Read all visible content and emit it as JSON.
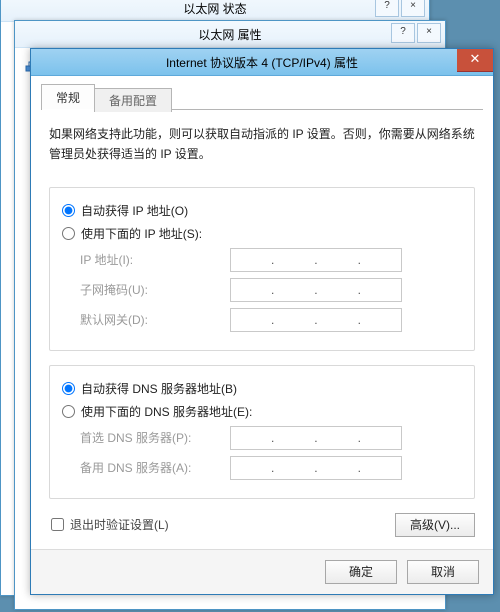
{
  "bg": {
    "win1_title": "以太网 状态",
    "win2_title": "以太网 属性"
  },
  "dialog": {
    "title": "Internet 协议版本 4 (TCP/IPv4) 属性",
    "tabs": {
      "general": "常规",
      "alt": "备用配置"
    },
    "description": "如果网络支持此功能，则可以获取自动指派的 IP 设置。否则，你需要从网络系统管理员处获得适当的 IP 设置。",
    "ip": {
      "auto": "自动获得 IP 地址(O)",
      "manual": "使用下面的 IP 地址(S):",
      "addr_label": "IP 地址(I):",
      "mask_label": "子网掩码(U):",
      "gw_label": "默认网关(D):"
    },
    "dns": {
      "auto": "自动获得 DNS 服务器地址(B)",
      "manual": "使用下面的 DNS 服务器地址(E):",
      "pref_label": "首选 DNS 服务器(P):",
      "alt_label": "备用 DNS 服务器(A):"
    },
    "validate_checkbox": "退出时验证设置(L)",
    "advanced_btn": "高级(V)...",
    "ok_btn": "确定",
    "cancel_btn": "取消"
  }
}
